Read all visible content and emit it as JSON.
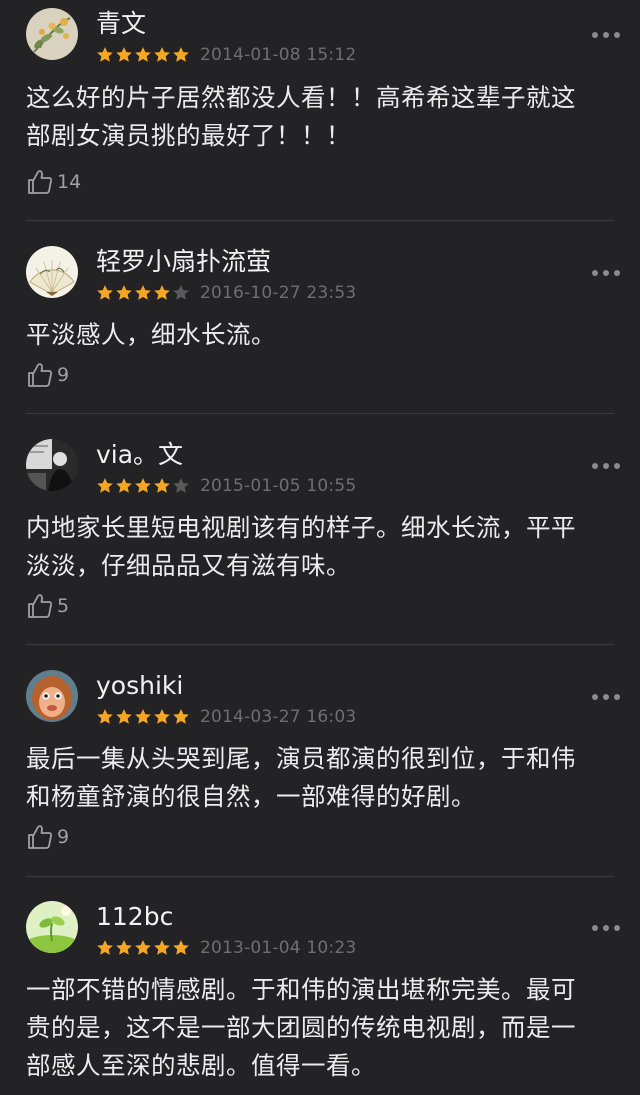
{
  "reviews": [
    {
      "user": "青文",
      "avatar_icon": "flower-painting-avatar",
      "rating": 5,
      "date": "2014-01-08 15:12",
      "lines": [
        "这么好的片子居然都没人看！！高希希这辈子就这",
        "部剧女演员挑的最好了！！！"
      ],
      "likes": "14"
    },
    {
      "user": "轻罗小扇扑流萤",
      "avatar_icon": "folding-fan-avatar",
      "rating": 4,
      "date": "2016-10-27 23:53",
      "lines": [
        "平淡感人，细水长流。"
      ],
      "likes": "9"
    },
    {
      "user": "via。文",
      "avatar_icon": "black-white-photo-avatar",
      "rating": 4,
      "date": "2015-01-05 10:55",
      "lines": [
        "内地家长里短电视剧该有的样子。细水长流，平平",
        "淡淡，仔细品品又有滋有味。"
      ],
      "likes": "5"
    },
    {
      "user": "yoshiki",
      "avatar_icon": "monkey-avatar",
      "rating": 5,
      "date": "2014-03-27 16:03",
      "lines": [
        "最后一集从头哭到尾，演员都演的很到位，于和伟",
        "和杨童舒演的很自然，一部难得的好剧。"
      ],
      "likes": "9"
    },
    {
      "user": "112bc",
      "avatar_icon": "green-sprout-avatar",
      "rating": 5,
      "date": "2013-01-04 10:23",
      "lines": [
        "一部不错的情感剧。于和伟的演出堪称完美。最可",
        "贵的是，这不是一部大团圆的传统电视剧，而是一",
        "部感人至深的悲剧。值得一看。"
      ],
      "likes": ""
    }
  ],
  "colors": {
    "background": "#232325",
    "star_filled": "#f5a623",
    "star_empty": "#5a5a5e",
    "date_text": "#6e6e73",
    "divider": "#3a3a3d"
  },
  "icons": {
    "more": "more-dots-icon",
    "like": "thumbs-up-icon",
    "star": "star-icon"
  }
}
